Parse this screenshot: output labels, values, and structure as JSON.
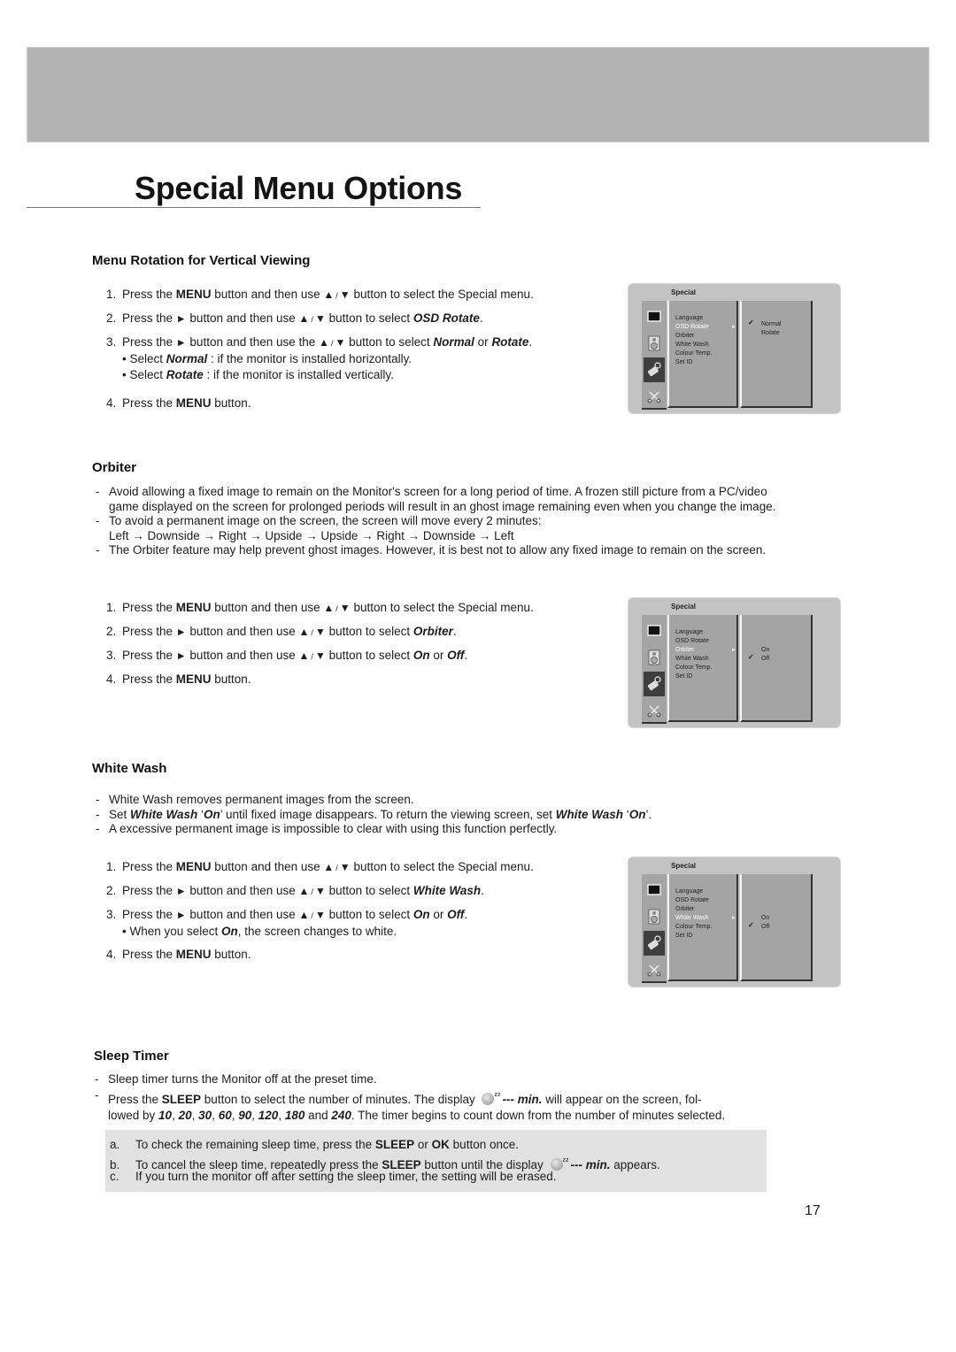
{
  "page": {
    "title": "Special Menu Options",
    "page_number": "17"
  },
  "menu_rotation": {
    "heading": "Menu Rotation for Vertical Viewing",
    "steps": [
      {
        "num": "1.",
        "parts": [
          "Press the ",
          "MENU",
          " button and then use ",
          "▲",
          "/",
          "▼",
          " button to select the Special menu."
        ]
      },
      {
        "num": "2.",
        "parts": [
          "Press the ",
          "►",
          " button and then use ",
          "▲",
          "/",
          "▼",
          " button to select ",
          "OSD Rotate",
          "."
        ]
      },
      {
        "num": "3.",
        "parts": [
          "Press the ",
          "►",
          " button and then use the ",
          "▲",
          "/",
          "▼",
          " button to select ",
          "Normal",
          " or ",
          "Rotate",
          "."
        ]
      },
      {
        "num": "4.",
        "parts": [
          "Press the ",
          "MENU",
          " button."
        ]
      }
    ],
    "sub_bullets": [
      {
        "prefix": "• Select ",
        "key": "Normal",
        "text": " : if the monitor is installed horizontally."
      },
      {
        "prefix": "• Select ",
        "key": "Rotate",
        "text": " : if the monitor is installed vertically."
      }
    ],
    "osd": {
      "title": "Special",
      "menu_items": [
        "Language",
        "OSD Rotate",
        "Orbiter",
        "White Wash",
        "Colour Temp.",
        "Set ID"
      ],
      "selected_item": "OSD Rotate",
      "options": [
        "Normal",
        "Rotate"
      ],
      "checked_option": "Normal"
    }
  },
  "orbiter": {
    "heading": "Orbiter",
    "bullets": [
      "Avoid allowing a fixed image to remain on the Monitor's screen for a long period of time. A frozen still picture from a PC/video game displayed on the screen for prolonged periods will result in an ghost image remaining even when you change the image.",
      "To avoid a permanent image on the screen, the screen will move every 2 minutes:",
      "The Orbiter feature may help prevent ghost images. However, it is best not to allow any fixed image to remain on the screen."
    ],
    "movement_sequence": "Left → Downside → Right → Upside → Upside → Right → Downside → Left",
    "steps": [
      {
        "num": "1.",
        "parts": [
          "Press the ",
          "MENU",
          " button and then use ",
          "▲",
          "/",
          "▼",
          " button to select the Special menu."
        ]
      },
      {
        "num": "2.",
        "parts": [
          "Press the ",
          "►",
          " button and then use ",
          "▲",
          "/",
          "▼",
          " button to select ",
          "Orbiter",
          "."
        ]
      },
      {
        "num": "3.",
        "parts": [
          "Press the ",
          "►",
          " button and then use ",
          "▲",
          "/",
          "▼",
          " button to select ",
          "On",
          " or ",
          "Off",
          "."
        ]
      },
      {
        "num": "4.",
        "parts": [
          "Press the ",
          "MENU",
          " button."
        ]
      }
    ],
    "osd": {
      "title": "Special",
      "menu_items": [
        "Language",
        "OSD Rotate",
        "Orbiter",
        "White Wash",
        "Colour Temp.",
        "Set ID"
      ],
      "selected_item": "Orbiter",
      "options": [
        "On",
        "Off"
      ],
      "checked_option": "Off"
    }
  },
  "white_wash": {
    "heading": "White Wash",
    "bullets": [
      "White Wash removes permanent images from the screen.",
      "Set White Wash ‘On’ until fixed image disappears. To return the viewing screen, set White Wash ‘On’.",
      "A excessive permanent image is impossible to clear with using this function perfectly."
    ],
    "steps": [
      {
        "num": "1.",
        "parts": [
          "Press the ",
          "MENU",
          " button and then use ",
          "▲",
          "/",
          "▼",
          " button to select the Special menu."
        ]
      },
      {
        "num": "2.",
        "parts": [
          "Press the ",
          "►",
          " button and then use ",
          "▲",
          "/",
          "▼",
          " button to select ",
          "White Wash",
          "."
        ]
      },
      {
        "num": "3.",
        "parts": [
          "Press the ",
          "►",
          " button and then use ",
          "▲",
          "/",
          "▼",
          " button to select ",
          "On",
          " or ",
          "Off",
          "."
        ]
      },
      {
        "num": "4.",
        "parts": [
          "Press the ",
          "MENU",
          " button."
        ]
      }
    ],
    "sub_bullet": {
      "prefix": "• When you select ",
      "key": "On",
      "text": ", the screen changes to white."
    },
    "osd": {
      "title": "Special",
      "menu_items": [
        "Language",
        "OSD Rotate",
        "Orbiter",
        "White Wash",
        "Colour Temp.",
        "Set ID"
      ],
      "selected_item": "White Wash",
      "options": [
        "On",
        "Off"
      ],
      "checked_option": "Off"
    }
  },
  "sleep_timer": {
    "heading": "Sleep Timer",
    "bullet1": "Sleep timer turns the Monitor off at the preset time.",
    "bullet2_a": "Press the ",
    "bullet2_key": "SLEEP",
    "bullet2_b": " button to select the number of minutes. The display ",
    "display_text": "--- min.",
    "bullet2_c": " will appear on the screen, fol-",
    "bullet2_line2_a": "lowed by ",
    "minute_values": [
      "10",
      "20",
      "30",
      "60",
      "90",
      "120",
      "180",
      "240"
    ],
    "bullet2_line2_b": ". The timer begins to count down from the number of minutes selected.",
    "notes": [
      {
        "label": "a.",
        "text_a": "To check the remaining sleep time, press the ",
        "key1": "SLEEP",
        "mid": " or ",
        "key2": "OK",
        "text_b": " button once."
      },
      {
        "label": "b.",
        "text_a": "To cancel the sleep time, repeatedly press the ",
        "key1": "SLEEP",
        "mid": " button until the display ",
        "display": "--- min.",
        "text_b": " appears."
      },
      {
        "label": "c.",
        "text_a": "If you turn the monitor off after setting the sleep timer, the setting will be erased."
      }
    ]
  }
}
